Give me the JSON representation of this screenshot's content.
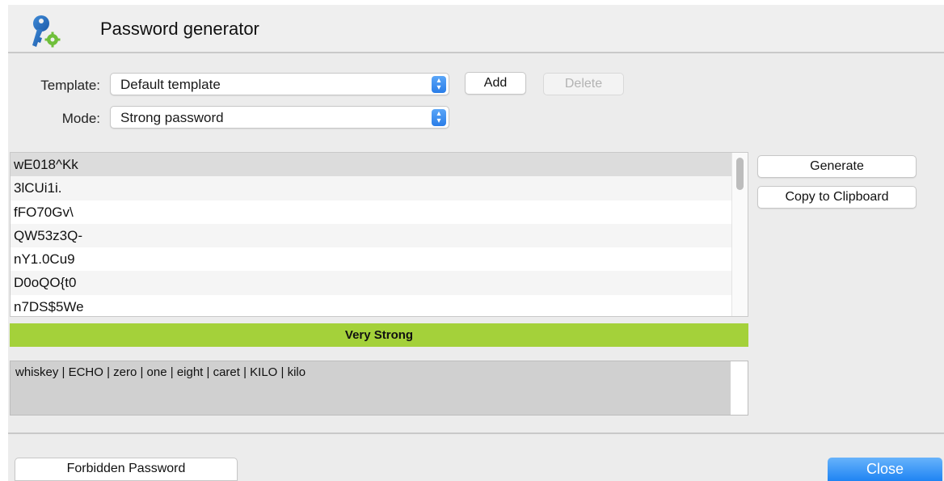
{
  "window": {
    "title": "Password generator"
  },
  "form": {
    "template_label": "Template:",
    "template_value": "Default template",
    "add_label": "Add",
    "delete_label": "Delete",
    "mode_label": "Mode:",
    "mode_value": "Strong password"
  },
  "passwords": [
    "wE018^Kk",
    "3lCUi1i.",
    "fFO70Gv\\",
    "QW53z3Q-",
    "nY1.0Cu9",
    "D0oQO{t0",
    "n7DS$5We"
  ],
  "selected_index": 0,
  "actions": {
    "generate_label": "Generate",
    "copy_label": "Copy to Clipboard"
  },
  "strength": {
    "label": "Very Strong",
    "color": "#a4d13a"
  },
  "phonetic": {
    "text": "whiskey | ECHO | zero | one | eight | caret | KILO | kilo"
  },
  "footer": {
    "forbidden_label": "Forbidden Password",
    "close_label": "Close"
  },
  "icons": {
    "app": "key-gear-icon",
    "select_arrows": "chevron-up-down-icon"
  }
}
